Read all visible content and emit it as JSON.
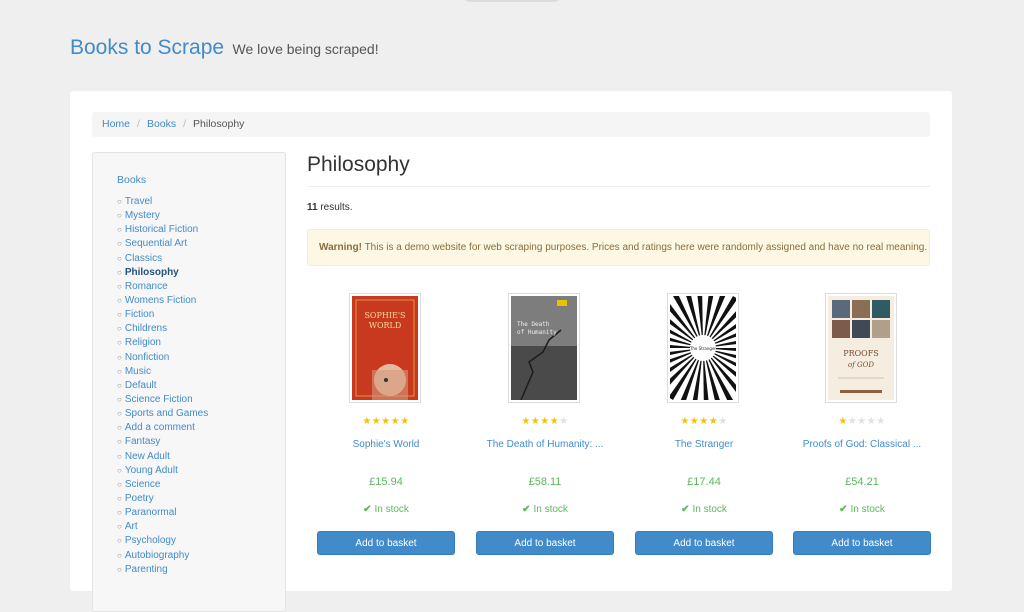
{
  "header": {
    "brand": "Books to Scrape",
    "tagline": "We love being scraped!"
  },
  "breadcrumb": {
    "home": "Home",
    "books": "Books",
    "current": "Philosophy"
  },
  "sidebar": {
    "root": "Books",
    "categories": [
      "Travel",
      "Mystery",
      "Historical Fiction",
      "Sequential Art",
      "Classics",
      "Philosophy",
      "Romance",
      "Womens Fiction",
      "Fiction",
      "Childrens",
      "Religion",
      "Nonfiction",
      "Music",
      "Default",
      "Science Fiction",
      "Sports and Games",
      "Add a comment",
      "Fantasy",
      "New Adult",
      "Young Adult",
      "Science",
      "Poetry",
      "Paranormal",
      "Art",
      "Psychology",
      "Autobiography",
      "Parenting"
    ],
    "active": "Philosophy"
  },
  "main": {
    "title": "Philosophy",
    "results_count": "11",
    "results_suffix": " results.",
    "alert_strong": "Warning!",
    "alert_text": " This is a demo website for web scraping purposes. Prices and ratings here were randomly assigned and have no real meaning."
  },
  "products": [
    {
      "title": "Sophie's World",
      "price": "£15.94",
      "stock": "In stock",
      "rating": 5,
      "button": "Add to basket",
      "cover_lines": [
        "SOPHIE'S",
        "WORLD"
      ]
    },
    {
      "title": "The Death of Humanity: ...",
      "price": "£58.11",
      "stock": "In stock",
      "rating": 4,
      "button": "Add to basket",
      "cover_lines": [
        "The Death",
        "of Humanity"
      ]
    },
    {
      "title": "The Stranger",
      "price": "£17.44",
      "stock": "In stock",
      "rating": 4,
      "button": "Add to basket",
      "cover_lines": [
        "The Stranger"
      ]
    },
    {
      "title": "Proofs of God: Classical ...",
      "price": "£54.21",
      "stock": "In stock",
      "rating": 1,
      "button": "Add to basket",
      "cover_lines": [
        "PROOFS",
        "of GOD"
      ]
    }
  ],
  "colors": {
    "link": "#428bca",
    "price": "#5cb85c",
    "star": "#f0c20f",
    "button": "#428bca",
    "alert_bg": "#fcf8e3"
  }
}
